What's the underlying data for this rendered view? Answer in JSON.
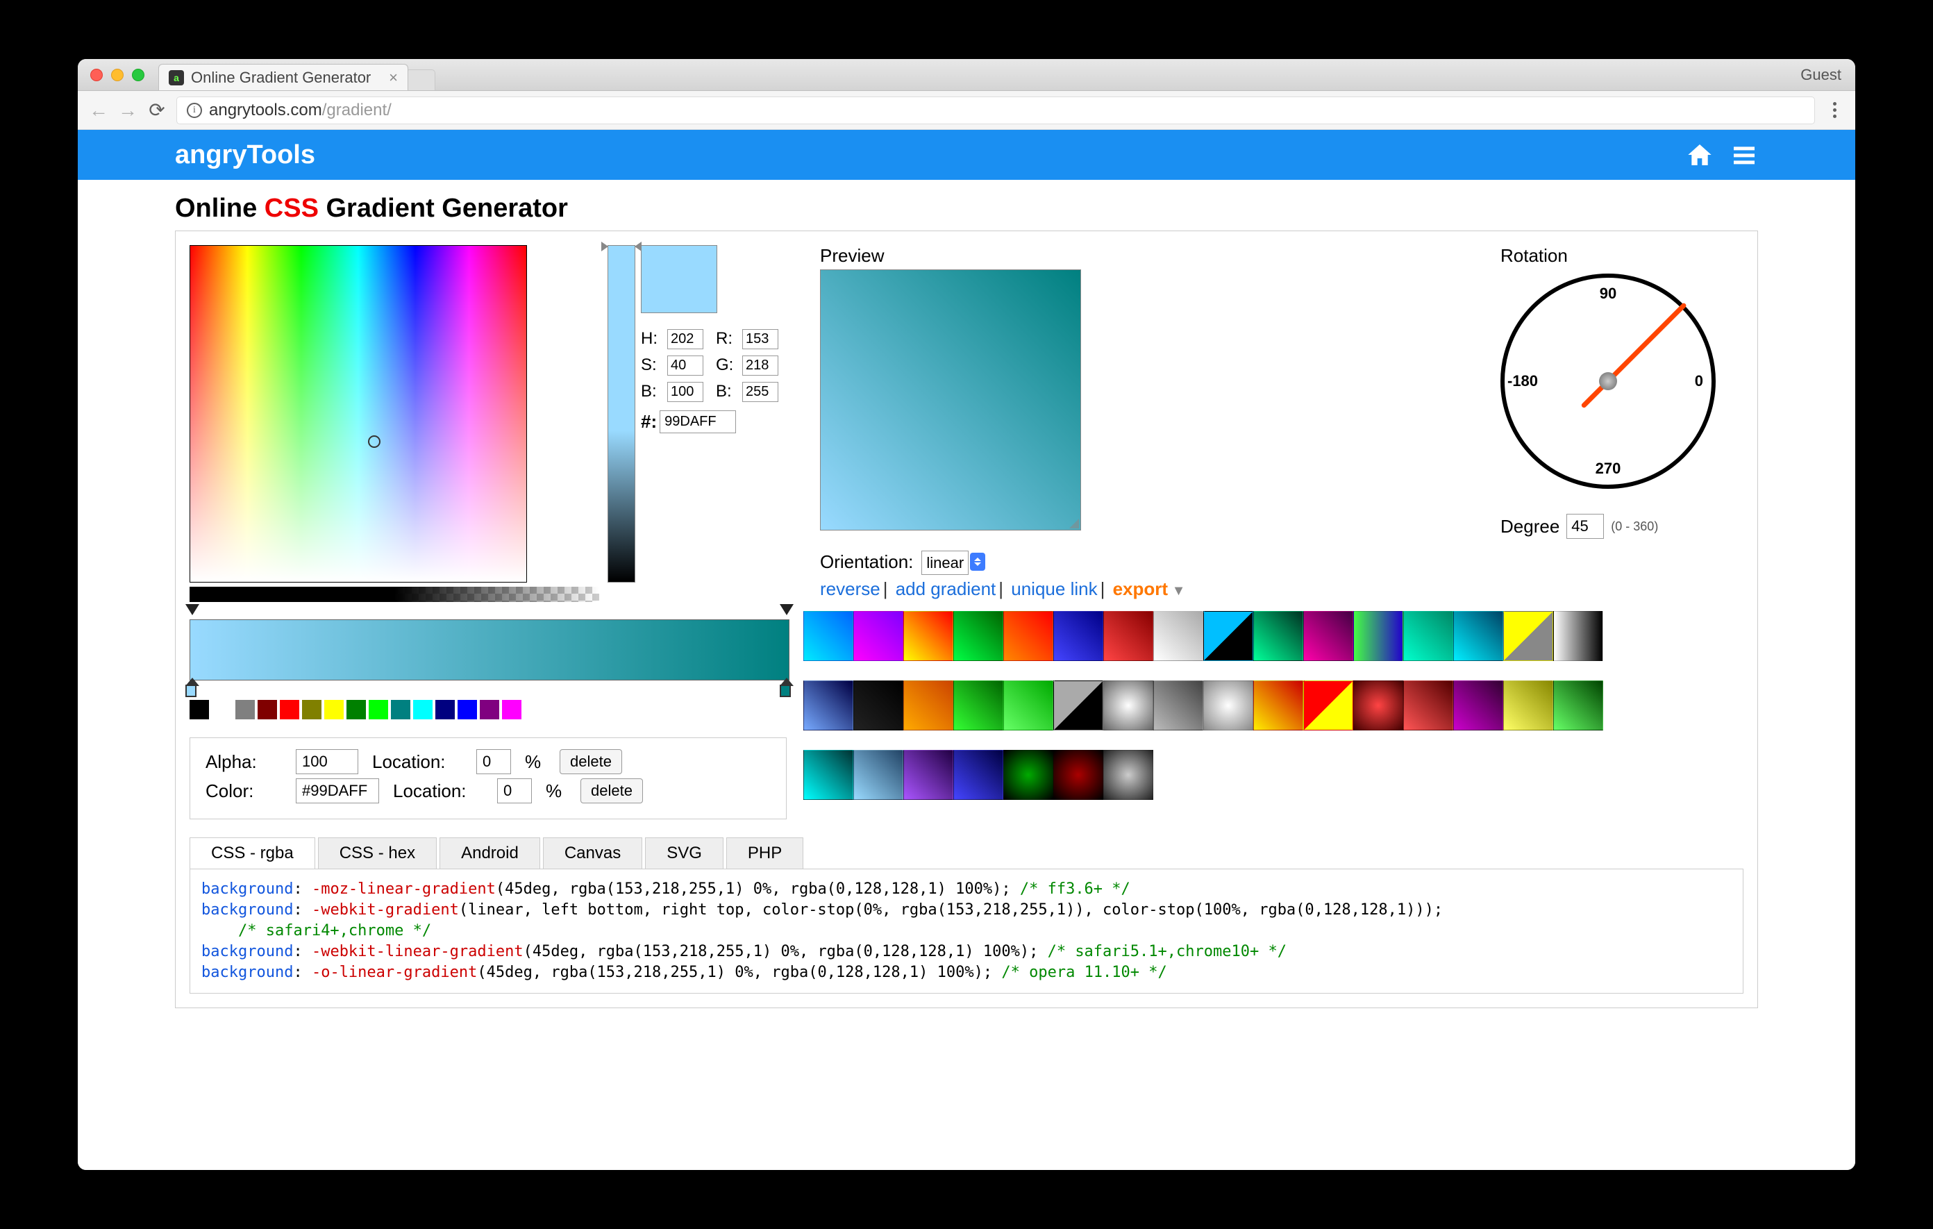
{
  "browser": {
    "tab_title": "Online Gradient Generator",
    "guest": "Guest",
    "url_host": "angrytools.com",
    "url_path": "/gradient/"
  },
  "header": {
    "logo": "angryTools"
  },
  "page_title": {
    "pre": "Online ",
    "css": "CSS",
    "post": " Gradient Generator"
  },
  "hsv": {
    "H": "H:",
    "Hval": "202",
    "S": "S:",
    "Sval": "40",
    "B": "B:",
    "Bval": "100",
    "R": "R:",
    "Rval": "153",
    "G": "G:",
    "Gval": "218",
    "B2": "B:",
    "B2val": "255",
    "hash": "#:",
    "hex": "99DAFF"
  },
  "preview_label": "Preview",
  "orientation_label": "Orientation:",
  "orientation_value": "linear",
  "rotation_label": "Rotation",
  "dial": {
    "t90": "90",
    "t0": "0",
    "t270": "270",
    "t180": "-180"
  },
  "degree_label": "Degree",
  "degree_value": "45",
  "degree_hint": "(0 - 360)",
  "links": {
    "reverse": "reverse",
    "add": "add gradient",
    "unique": "unique link",
    "export": "export"
  },
  "palette": [
    "#000000",
    "#808080",
    "#800000",
    "#ff0000",
    "#808000",
    "#ffff00",
    "#008000",
    "#00ff00",
    "#008080",
    "#00ffff",
    "#000080",
    "#0000ff",
    "#800080",
    "#ff00ff"
  ],
  "controls": {
    "alpha_lbl": "Alpha:",
    "alpha": "100",
    "color_lbl": "Color:",
    "color": "#99DAFF",
    "loc_lbl": "Location:",
    "loc": "0",
    "pct": "%",
    "delete": "delete"
  },
  "tabs": [
    "CSS - rgba",
    "CSS - hex",
    "Android",
    "Canvas",
    "SVG",
    "PHP"
  ],
  "code_lines": [
    {
      "t": "background",
      "v": "-moz-linear-gradient",
      "a": "(45deg, rgba(153,218,255,1) 0%, rgba(0,128,128,1) 100%);",
      "c": "/* ff3.6+ */"
    },
    {
      "t": "background",
      "v": "-webkit-gradient",
      "a": "(linear, left bottom, right top, color-stop(0%, rgba(153,218,255,1)), color-stop(100%, rgba(0,128,128,1)));",
      "c": "/* safari4+,chrome */"
    },
    {
      "t": "background",
      "v": "-webkit-linear-gradient",
      "a": "(45deg, rgba(153,218,255,1) 0%, rgba(0,128,128,1) 100%);",
      "c": "/* safari5.1+,chrome10+ */"
    },
    {
      "t": "background",
      "v": "-o-linear-gradient",
      "a": "(45deg, rgba(153,218,255,1) 0%, rgba(0,128,128,1) 100%);",
      "c": "/* opera 11.10+ */"
    }
  ],
  "presets": [
    "linear-gradient(45deg,#00eaff,#0066ff)",
    "linear-gradient(45deg,#ff00ff,#8000ff)",
    "linear-gradient(45deg,#ffff00,#ff0000)",
    "linear-gradient(45deg,#00ff44,#006600)",
    "linear-gradient(45deg,#ff8800,#ff0000)",
    "linear-gradient(45deg,#4444ff,#000088)",
    "linear-gradient(45deg,#ff4444,#880000)",
    "linear-gradient(45deg,#fff,#aaa)",
    "linear-gradient(135deg,#00bfff 50%,#000 50%)",
    "linear-gradient(45deg,#00ff99,#003322)",
    "linear-gradient(45deg,#ff00aa,#440044)",
    "linear-gradient(90deg,#44ff44,#2200cc)",
    "linear-gradient(45deg,#00ffcc,#008866)",
    "linear-gradient(45deg,#00eeff,#004466)",
    "linear-gradient(135deg,#ff0 50%,#888 50%)",
    "linear-gradient(90deg,#fff,#000)",
    "linear-gradient(45deg,#7af,#004)",
    "linear-gradient(45deg,#222,#000)",
    "linear-gradient(45deg,#ffaa00,#cc4400)",
    "linear-gradient(45deg,#33ff33,#006600)",
    "linear-gradient(45deg,#66ff66,#00aa00)",
    "linear-gradient(135deg,#aaa 50%,#000 50%)",
    "radial-gradient(#fff,#666)",
    "linear-gradient(45deg,#bbb,#444)",
    "radial-gradient(#fff,#888)",
    "linear-gradient(45deg,#ffee00,#cc0000)",
    "linear-gradient(135deg,#f00 50%,#ff0 50%)",
    "radial-gradient(#f44,#400)",
    "linear-gradient(45deg,#ff5555,#550000)",
    "linear-gradient(45deg,#cc00cc,#330033)",
    "linear-gradient(45deg,#ffff66,#888800)",
    "linear-gradient(45deg,#66ff66,#004400)",
    "linear-gradient(45deg,#00ffff,#003333)",
    "linear-gradient(45deg,#99daff,#224466)",
    "linear-gradient(45deg,#aa55ff,#220044)",
    "linear-gradient(45deg,#4444ff,#000044)",
    "radial-gradient(#0a0,#000)",
    "radial-gradient(#a00,#000)",
    "radial-gradient(#ccc,#222)"
  ]
}
